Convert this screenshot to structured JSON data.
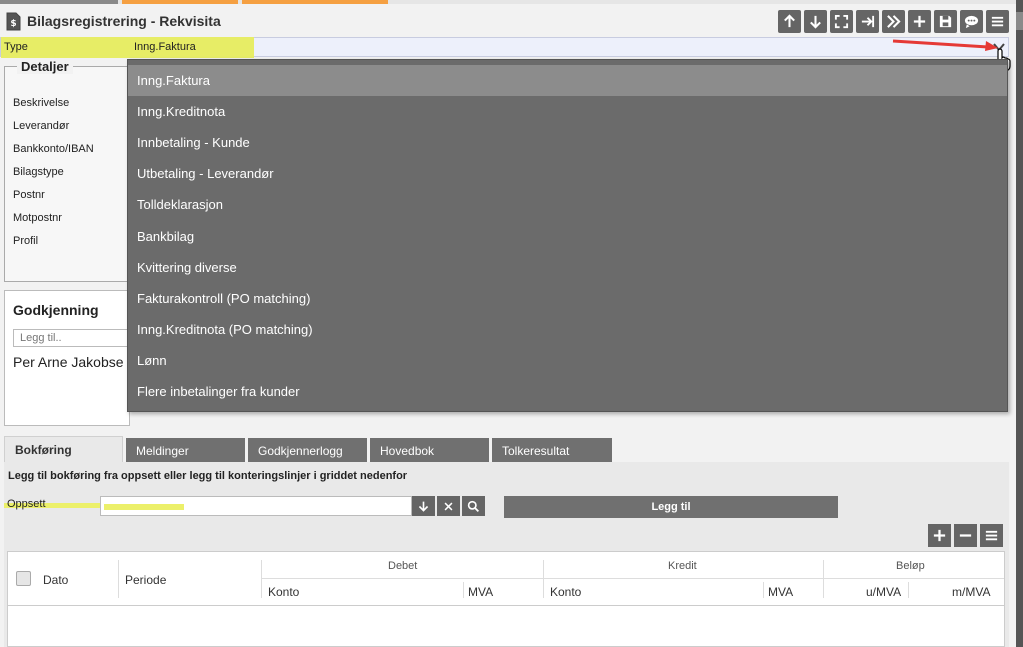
{
  "window": {
    "title": "Bilagsregistrering - Rekvisita"
  },
  "toolbar": {
    "buttons": [
      {
        "icon": "arrow-up-icon"
      },
      {
        "icon": "arrow-down-icon"
      },
      {
        "icon": "fullscreen-icon"
      },
      {
        "icon": "jump-to-end-icon"
      },
      {
        "icon": "double-chevron-right-icon"
      },
      {
        "icon": "plus-icon"
      },
      {
        "icon": "save-icon"
      },
      {
        "icon": "chat-icon"
      },
      {
        "icon": "menu-icon"
      }
    ]
  },
  "type_field": {
    "label": "Type",
    "value": "Inng.Faktura"
  },
  "detaljer": {
    "legend": "Detaljer",
    "fields": [
      "Beskrivelse",
      "Leverandør",
      "Bankkonto/IBAN",
      "Bilagstype",
      "Postnr",
      "Motpostnr",
      "Profil"
    ]
  },
  "godkjenning": {
    "title": "Godkjenning",
    "input_placeholder": "Legg til..",
    "person": "Per Arne Jakobse"
  },
  "dropdown": {
    "selected_index": 0,
    "options": [
      "Inng.Faktura",
      "Inng.Kreditnota",
      "Innbetaling - Kunde",
      "Utbetaling - Leverandør",
      "Tolldeklarasjon",
      "Bankbilag",
      "Kvittering diverse",
      "Fakturakontroll (PO matching)",
      "Inng.Kreditnota (PO matching)",
      "Lønn",
      "Flere inbetalinger fra kunder"
    ]
  },
  "tabs": [
    "Bokføring",
    "Meldinger",
    "Godkjennerlogg",
    "Hovedbok",
    "Tolkeresultat"
  ],
  "bokforing": {
    "hint": "Legg til bokføring fra oppsett eller legg til konteringslinjer i griddet nedenfor",
    "oppsett_label": "Oppsett",
    "oppsett_value": "",
    "legg_til_label": "Legg til"
  },
  "grid": {
    "col_dato": "Dato",
    "col_periode": "Periode",
    "group_debet": "Debet",
    "group_kredit": "Kredit",
    "group_belop": "Beløp",
    "debet_konto": "Konto",
    "debet_mva": "MVA",
    "kredit_konto": "Konto",
    "kredit_mva": "MVA",
    "belop_umva": "u/MVA",
    "belop_mmva": "m/MVA"
  },
  "colors": {
    "highlight_yellow": "#e7ed66",
    "button_gray": "#656565",
    "dropdown_bg": "#6b6b6b",
    "dropdown_selected": "#8c8c8c",
    "annotation_red": "#e53935"
  }
}
